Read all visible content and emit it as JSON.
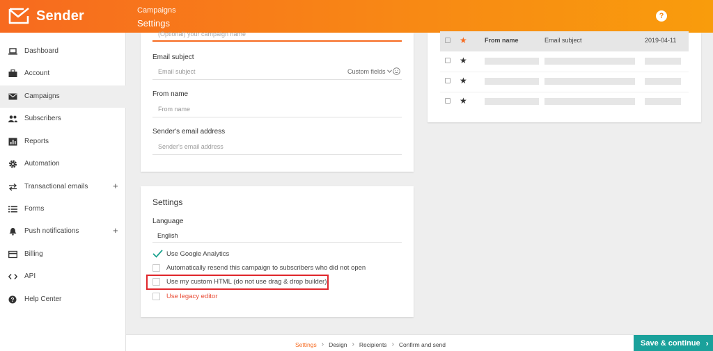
{
  "brand": {
    "name": "Sender",
    "accent": "#f76a1f",
    "teal": "#1aa19b",
    "highlight": "#e0262b"
  },
  "header": {
    "breadcrumb": "Campaigns",
    "title": "Settings",
    "help_icon": "?"
  },
  "sidebar": {
    "items": [
      {
        "label": "Dashboard",
        "icon": "laptop-icon"
      },
      {
        "label": "Account",
        "icon": "briefcase-icon"
      },
      {
        "label": "Campaigns",
        "icon": "envelope-icon",
        "active": true
      },
      {
        "label": "Subscribers",
        "icon": "people-icon"
      },
      {
        "label": "Reports",
        "icon": "chart-icon"
      },
      {
        "label": "Automation",
        "icon": "gear-icon"
      },
      {
        "label": "Transactional emails",
        "icon": "swap-icon",
        "expand": "+"
      },
      {
        "label": "Forms",
        "icon": "list-icon"
      },
      {
        "label": "Push notifications",
        "icon": "bell-icon",
        "expand": "+"
      },
      {
        "label": "Billing",
        "icon": "card-icon"
      },
      {
        "label": "API",
        "icon": "code-icon"
      },
      {
        "label": "Help Center",
        "icon": "help-icon"
      }
    ]
  },
  "form": {
    "campaign_name_placeholder": "(Optional) your campaign name",
    "email_subject": {
      "label": "Email subject",
      "placeholder": "Email subject",
      "custom_fields": "Custom fields"
    },
    "from_name": {
      "label": "From name",
      "placeholder": "From name"
    },
    "sender_email": {
      "label": "Sender's email address",
      "placeholder": "Sender's email address"
    }
  },
  "settings": {
    "title": "Settings",
    "language_label": "Language",
    "language_value": "English",
    "options": {
      "google_analytics": {
        "label": "Use Google Analytics",
        "checked": true
      },
      "auto_resend": {
        "label": "Automatically resend this campaign to subscribers who did not open",
        "checked": false
      },
      "custom_html": {
        "label": "Use my custom HTML (do not use drag & drop builder)",
        "checked": false
      },
      "legacy_editor": {
        "label": "Use legacy editor",
        "checked": false
      }
    }
  },
  "preview": {
    "header": {
      "from_name": "From name",
      "email_subject": "Email subject",
      "date": "2019-04-11"
    },
    "placeholder_rows": 3
  },
  "footer": {
    "steps": [
      "Settings",
      "Design",
      "Recipients",
      "Confirm and send"
    ],
    "current_step": "Settings",
    "save_label": "Save & continue",
    "save_arrow": "›"
  }
}
